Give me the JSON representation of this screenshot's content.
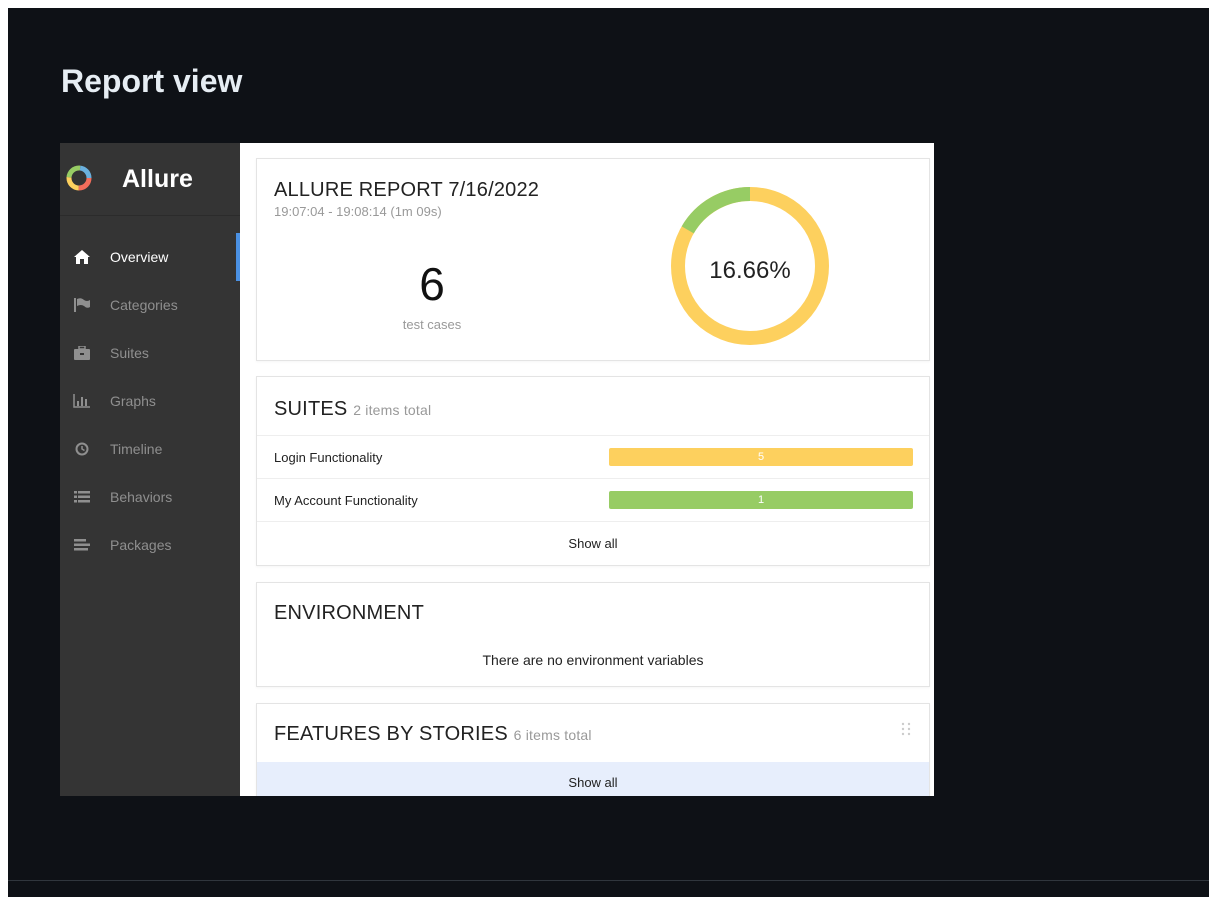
{
  "page": {
    "title": "Report view"
  },
  "sidebar": {
    "brand": "Allure",
    "items": [
      {
        "label": "Overview",
        "icon": "home-icon",
        "active": true
      },
      {
        "label": "Categories",
        "icon": "flag-icon",
        "active": false
      },
      {
        "label": "Suites",
        "icon": "briefcase-icon",
        "active": false
      },
      {
        "label": "Graphs",
        "icon": "bar-chart-icon",
        "active": false
      },
      {
        "label": "Timeline",
        "icon": "clock-icon",
        "active": false
      },
      {
        "label": "Behaviors",
        "icon": "list-icon",
        "active": false
      },
      {
        "label": "Packages",
        "icon": "align-left-icon",
        "active": false
      }
    ]
  },
  "summary": {
    "title": "ALLURE REPORT 7/16/2022",
    "time": "19:07:04 - 19:08:14 (1m 09s)",
    "count": "6",
    "count_label": "test cases",
    "percent_label": "16.66%",
    "donut": {
      "passed_fraction": 0.1666,
      "passed_color": "#97cc64",
      "broken_color": "#fdd05e"
    }
  },
  "suites": {
    "title": "SUITES",
    "subtitle": "2 items total",
    "rows": [
      {
        "name": "Login Functionality",
        "value": "5",
        "color": "#fdd05e"
      },
      {
        "name": "My Account Functionality",
        "value": "1",
        "color": "#97cc64"
      }
    ],
    "show_all": "Show all"
  },
  "environment": {
    "title": "ENVIRONMENT",
    "empty": "There are no environment variables"
  },
  "features": {
    "title": "FEATURES BY STORIES",
    "subtitle": "6 items total",
    "show_all": "Show all"
  }
}
